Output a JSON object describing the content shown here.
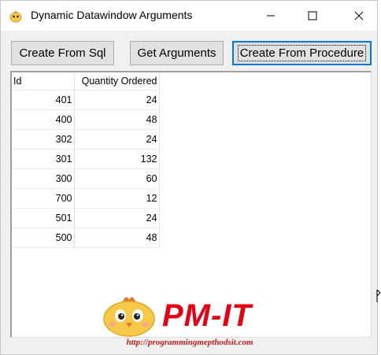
{
  "window": {
    "title": "Dynamic Datawindow Arguments",
    "controls": [
      "minimize",
      "maximize",
      "close"
    ]
  },
  "toolbar": {
    "buttons": [
      {
        "label": "Create From Sql"
      },
      {
        "label": "Get Arguments"
      },
      {
        "label": "Create From Procedure",
        "focused": true
      }
    ]
  },
  "datawindow": {
    "columns": [
      "Id",
      "Quantity Ordered"
    ],
    "rows": [
      [
        "401",
        "24"
      ],
      [
        "400",
        "48"
      ],
      [
        "302",
        "24"
      ],
      [
        "301",
        "132"
      ],
      [
        "300",
        "60"
      ],
      [
        "700",
        "12"
      ],
      [
        "501",
        "24"
      ],
      [
        "500",
        "48"
      ]
    ]
  },
  "watermark": {
    "brand": "PM-IT",
    "url": "http://programmingmepthodsit.com"
  },
  "colors": {
    "window_bg": "#f0f0f0",
    "button_bg": "#e1e1e1",
    "focus_border": "#0078d7",
    "brand_red": "#e60012"
  }
}
